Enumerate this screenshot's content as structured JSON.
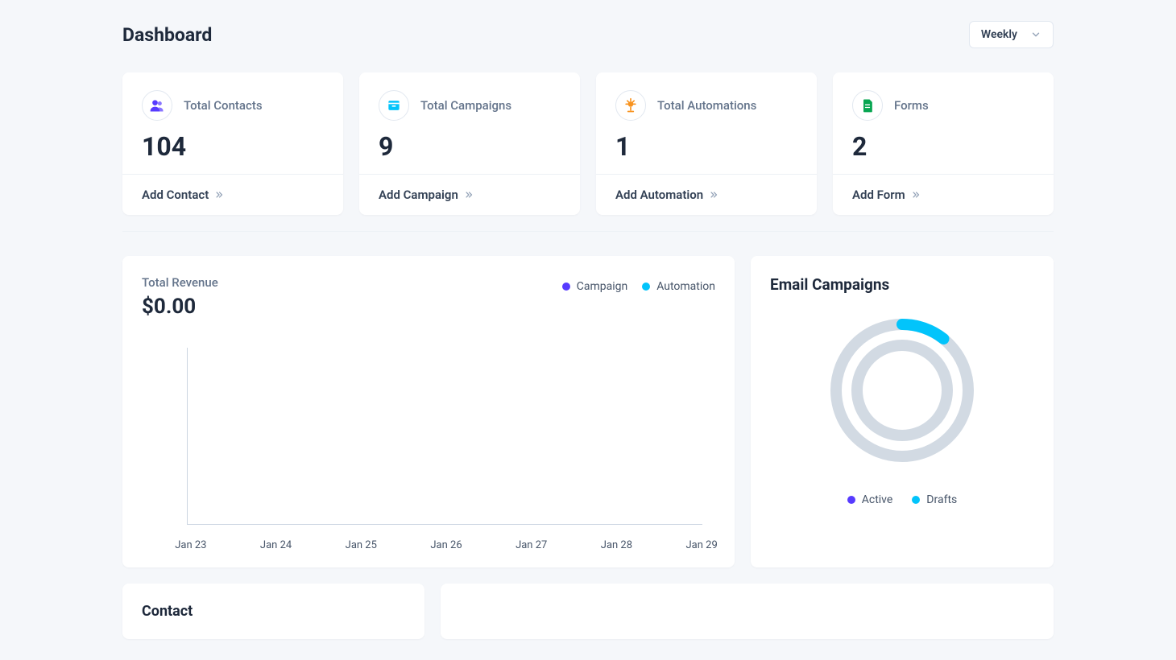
{
  "header": {
    "title": "Dashboard",
    "dropdown_label": "Weekly"
  },
  "stats": [
    {
      "label": "Total Contacts",
      "value": "104",
      "action": "Add Contact",
      "icon": "contacts",
      "color": "#573BFF"
    },
    {
      "label": "Total Campaigns",
      "value": "9",
      "action": "Add Campaign",
      "icon": "campaigns",
      "color": "#02C4FB"
    },
    {
      "label": "Total Automations",
      "value": "1",
      "action": "Add Automation",
      "icon": "automations",
      "color": "#F8931F"
    },
    {
      "label": "Forms",
      "value": "2",
      "action": "Add Form",
      "icon": "forms",
      "color": "#07A551"
    }
  ],
  "revenue": {
    "title": "Total Revenue",
    "value": "$0.00",
    "legend": [
      {
        "label": "Campaign",
        "color": "#573BFF"
      },
      {
        "label": "Automation",
        "color": "#02C4FB"
      }
    ]
  },
  "chart_data": {
    "type": "line",
    "title": "Total Revenue",
    "xlabel": "",
    "ylabel": "",
    "ylim": [
      0,
      1
    ],
    "categories": [
      "Jan 23",
      "Jan 24",
      "Jan 25",
      "Jan 26",
      "Jan 27",
      "Jan 28",
      "Jan 29"
    ],
    "series": [
      {
        "name": "Campaign",
        "color": "#573BFF",
        "values": [
          0,
          0,
          0,
          0,
          0,
          0,
          0
        ]
      },
      {
        "name": "Automation",
        "color": "#02C4FB",
        "values": [
          0,
          0,
          0,
          0,
          0,
          0,
          0
        ]
      }
    ]
  },
  "email_campaigns": {
    "title": "Email Campaigns",
    "donut": {
      "type": "pie",
      "series": [
        {
          "name": "Active",
          "color": "#573BFF",
          "value": 0
        },
        {
          "name": "Drafts",
          "color": "#02C4FB",
          "value": 1
        }
      ]
    },
    "legend": [
      {
        "label": "Active",
        "color": "#573BFF"
      },
      {
        "label": "Drafts",
        "color": "#02C4FB"
      }
    ]
  },
  "contact_card": {
    "title": "Contact"
  }
}
